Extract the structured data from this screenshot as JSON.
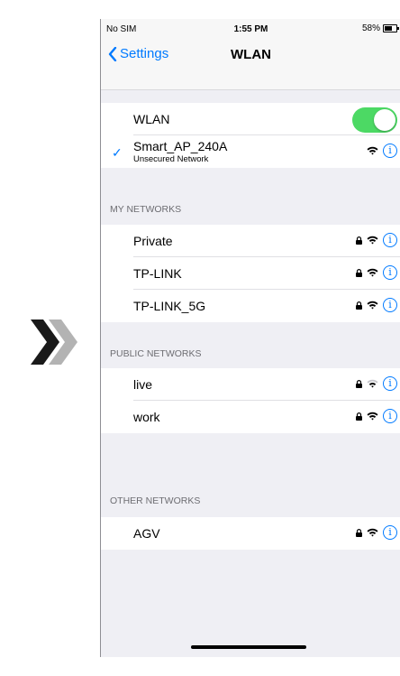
{
  "status": {
    "carrier": "No SIM",
    "time": "1:55 PM",
    "battery": "58%",
    "battery_level": 0.58
  },
  "nav": {
    "back_label": "Settings",
    "title": "WLAN"
  },
  "wlan": {
    "label": "WLAN",
    "enabled": true
  },
  "current": {
    "name": "Smart_AP_240A",
    "subtitle": "Unsecured Network",
    "icons": [
      "checkmark-icon",
      "wifi-icon",
      "info-icon"
    ]
  },
  "sections": {
    "my": {
      "header": "MY NETWORKS",
      "items": [
        {
          "name": "Private",
          "locked": true
        },
        {
          "name": "TP-LINK",
          "locked": true
        },
        {
          "name": "TP-LINK_5G",
          "locked": true
        }
      ]
    },
    "public": {
      "header": "PUBLIC NETWORKS",
      "items": [
        {
          "name": "live",
          "locked": true
        },
        {
          "name": "work",
          "locked": true
        }
      ]
    },
    "other": {
      "header": "OTHER NETWORKS",
      "items": [
        {
          "name": "AGV",
          "locked": true
        }
      ]
    }
  },
  "colors": {
    "accent": "#007aff",
    "toggle_on": "#4cd964",
    "arrow_dark": "#1a1a1a",
    "arrow_light": "#b3b3b3"
  },
  "info_glyph": "i",
  "check_glyph": "✓"
}
